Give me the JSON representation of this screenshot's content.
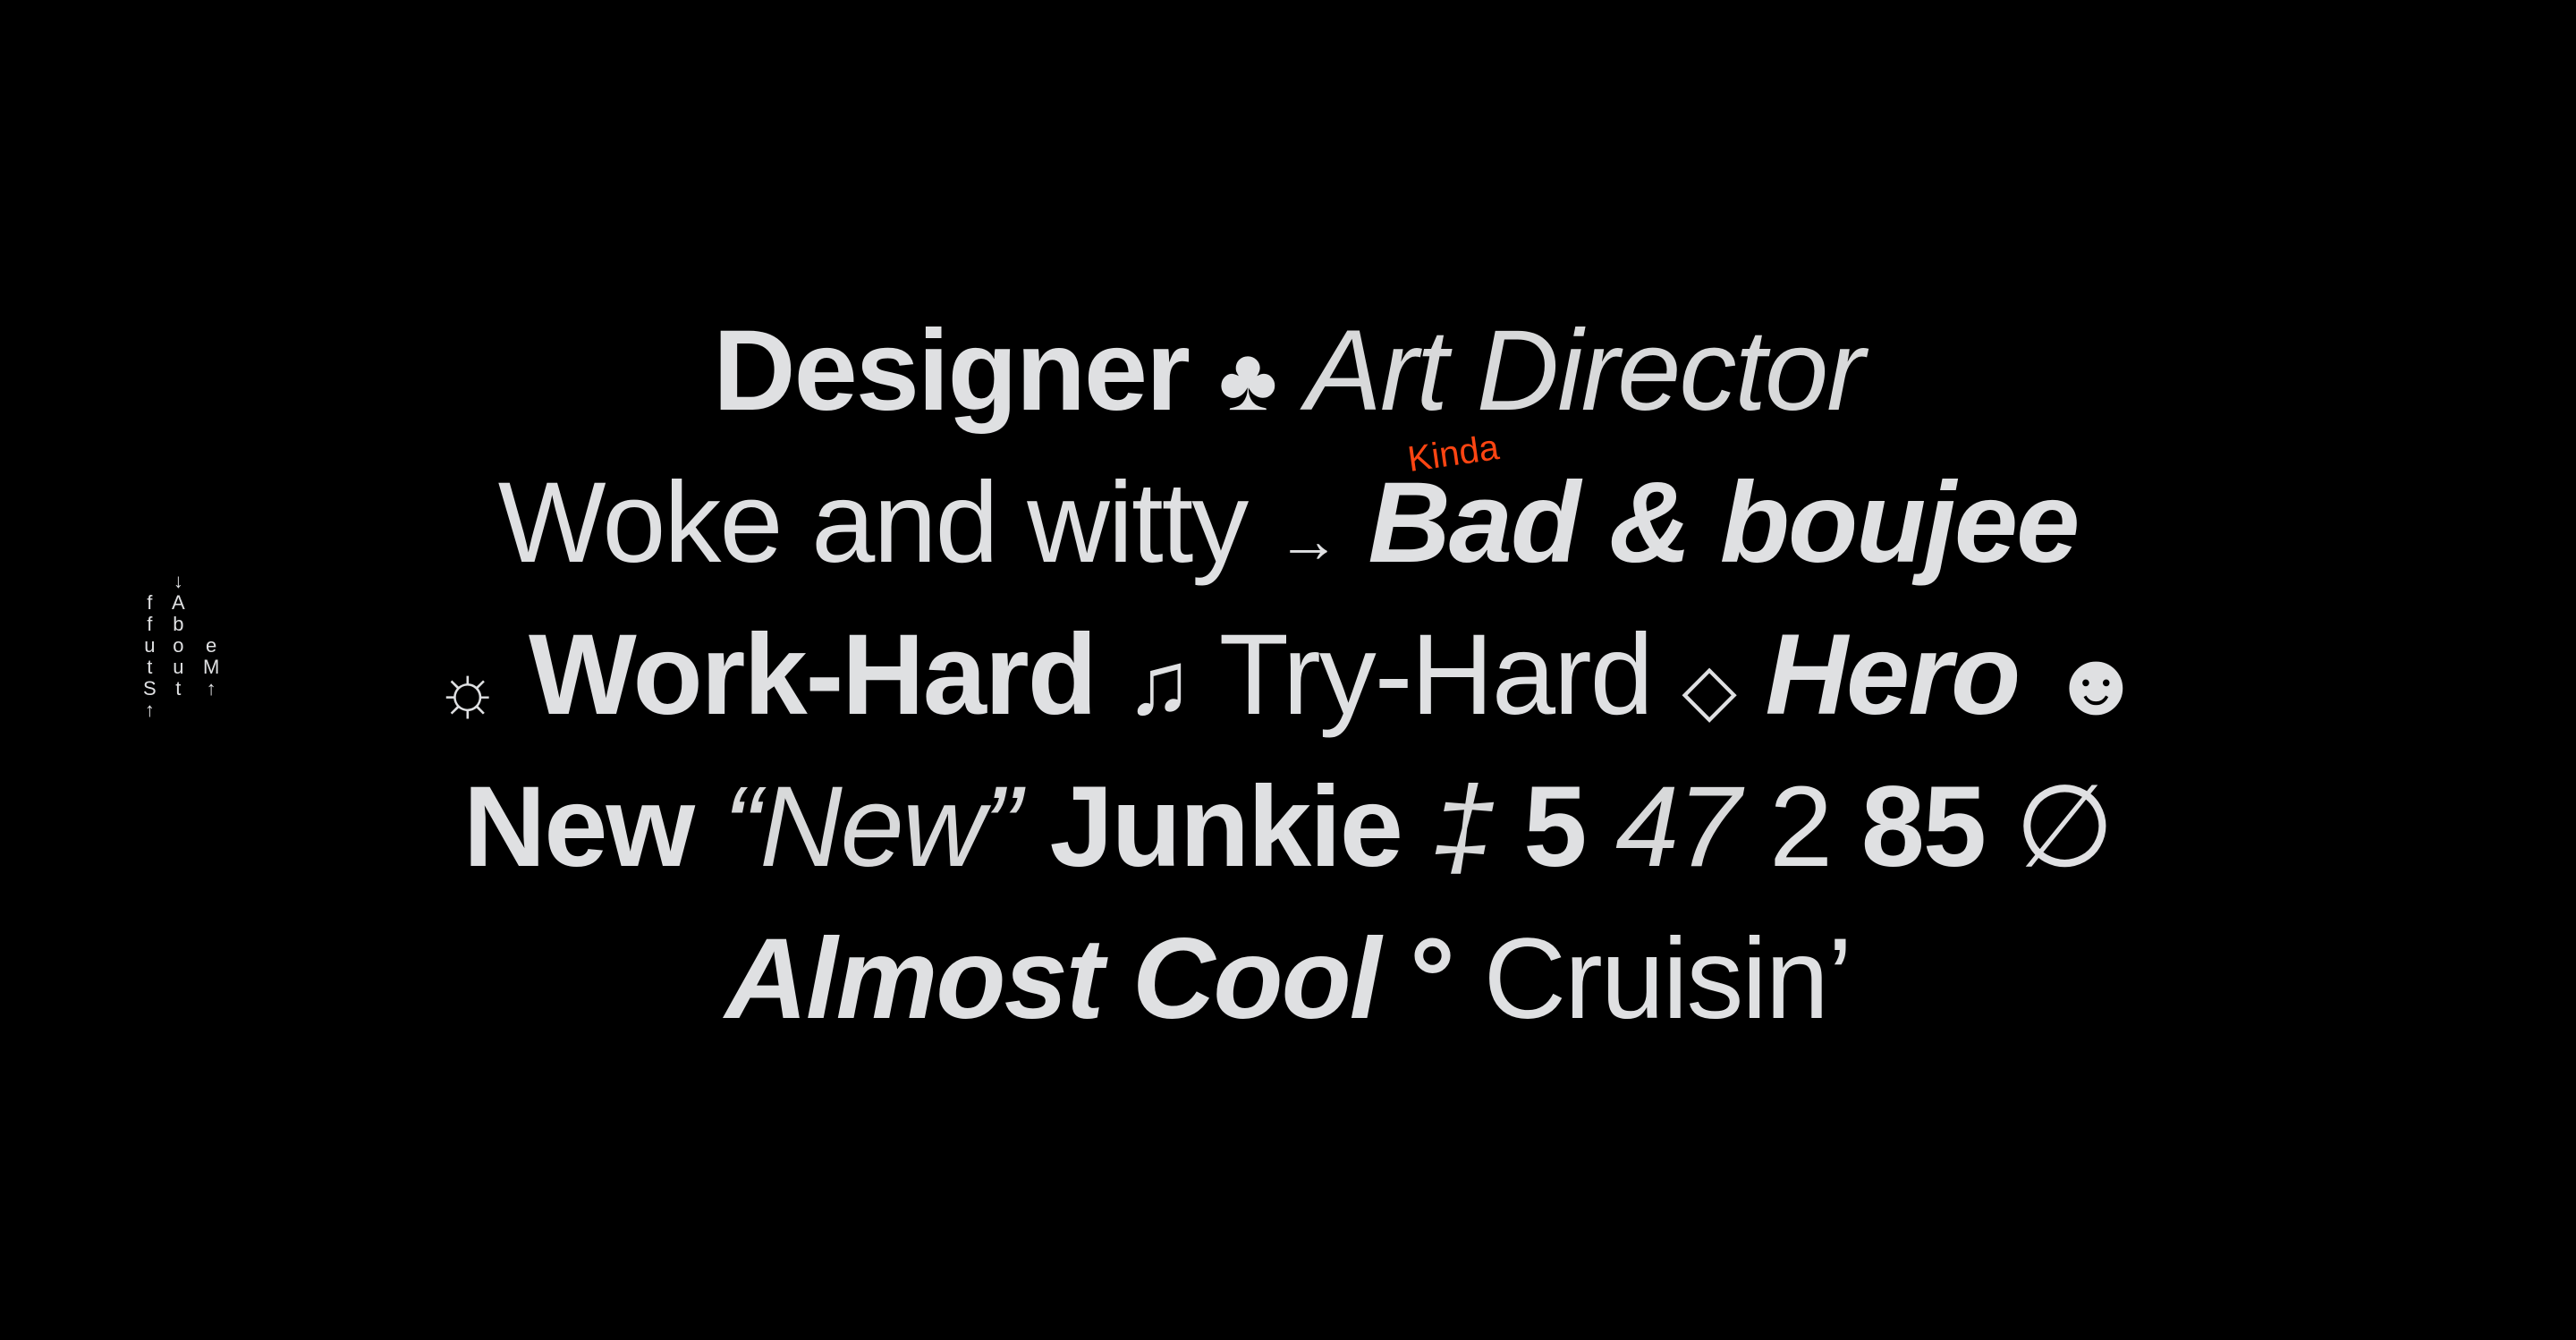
{
  "side_nav": {
    "stuff": {
      "arrow": "↑",
      "letters": [
        "f",
        "f",
        "u",
        "t",
        "S"
      ]
    },
    "about": {
      "arrow": "↓",
      "letters": [
        "A",
        "b",
        "o",
        "u",
        "t"
      ]
    },
    "me": {
      "arrow": "↑",
      "letters": [
        "e",
        "M"
      ]
    }
  },
  "lines": [
    [
      "Designer",
      "♣",
      "Art Director"
    ],
    [
      "Woke and witty",
      "→",
      "Bad & boujee",
      "Kinda"
    ],
    [
      "☼",
      "Work-Hard",
      "♫",
      "Try-Hard",
      "◇",
      "Hero",
      "☻"
    ],
    [
      "New",
      "“New”",
      "Junkie",
      "‡",
      "5",
      "47",
      "2",
      "85",
      "∅"
    ],
    [
      "Almost Cool",
      "°",
      "Cruisin’"
    ]
  ],
  "colors": {
    "text": "#dfe0e2",
    "accent": "#ff4512",
    "background": "#000000"
  }
}
